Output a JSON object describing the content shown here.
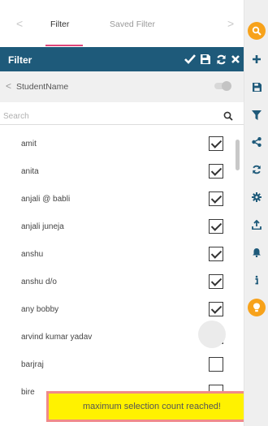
{
  "tabs": {
    "prev_arrow": "<",
    "next_arrow": ">",
    "items": [
      {
        "label": "Filter",
        "active": true
      },
      {
        "label": "Saved Filter",
        "active": false
      }
    ]
  },
  "filter_bar": {
    "title": "Filter",
    "icons": [
      "check-icon",
      "save-icon",
      "refresh-icon",
      "close-icon"
    ]
  },
  "field": {
    "back_arrow": "<",
    "name": "StudentName",
    "toggle_on": false
  },
  "search": {
    "placeholder": "Search",
    "value": ""
  },
  "list": {
    "items": [
      {
        "label": "amit",
        "checked": true
      },
      {
        "label": "anita",
        "checked": true
      },
      {
        "label": "anjali @ babli",
        "checked": true
      },
      {
        "label": "anjali juneja",
        "checked": true
      },
      {
        "label": "anshu",
        "checked": true
      },
      {
        "label": "anshu d/o",
        "checked": true
      },
      {
        "label": "any bobby",
        "checked": true
      },
      {
        "label": "arvind kumar yadav",
        "checked": false
      },
      {
        "label": "barjraj",
        "checked": false
      },
      {
        "label": "bire",
        "checked": false
      }
    ]
  },
  "toast": {
    "message": "maximum selection count reached!"
  },
  "toolbar": {
    "icons": [
      "search-icon",
      "plus-icon",
      "save-icon",
      "filter-icon",
      "share-icon",
      "refresh-icon",
      "settings-icon",
      "export-icon",
      "bell-icon",
      "info-icon",
      "lightbulb-icon"
    ]
  },
  "colors": {
    "header_bar": "#1e5a7a",
    "accent_orange": "#f7a21b",
    "tab_underline": "#e0467a",
    "toast_bg": "#fff200",
    "toast_border": "#f08a8a"
  }
}
